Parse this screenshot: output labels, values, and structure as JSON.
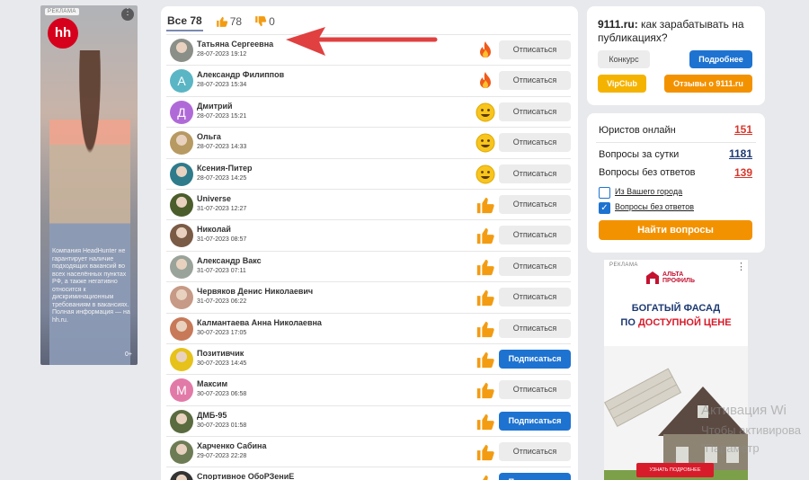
{
  "left_ad": {
    "tag": "РЕКЛАМА",
    "logo": "hh",
    "text": "Компания HeadHunter не гарантирует наличие подходящих вакансий во всех населённых пунктах РФ, а также негативно относится к дискриминационным требованиям в вакансиях. Полная информация — на hh.ru.",
    "age": "0+"
  },
  "tabs": {
    "all": "Все 78",
    "likes": "78",
    "dislikes": "0"
  },
  "rows": [
    {
      "name": "Татьяна Сергеевна",
      "date": "28-07-2023 19:12",
      "reaction": "fire",
      "button": "Отписаться",
      "subscribed": true,
      "avatar": "photo",
      "avatar_color": "#8a8f88"
    },
    {
      "name": "Александр Филиппов",
      "date": "28-07-2023 15:34",
      "reaction": "fire",
      "button": "Отписаться",
      "subscribed": true,
      "avatar": "А",
      "avatar_color": "#5ab6c4"
    },
    {
      "name": "Дмитрий",
      "date": "28-07-2023 15:21",
      "reaction": "smile",
      "button": "Отписаться",
      "subscribed": true,
      "avatar": "Д",
      "avatar_color": "#b06ad8"
    },
    {
      "name": "Ольга",
      "date": "28-07-2023 14:33",
      "reaction": "smile",
      "button": "Отписаться",
      "subscribed": true,
      "avatar": "photo",
      "avatar_color": "#b79a62"
    },
    {
      "name": "Ксения-Питер",
      "date": "28-07-2023 14:25",
      "reaction": "smile",
      "button": "Отписаться",
      "subscribed": true,
      "avatar": "photo",
      "avatar_color": "#2e7b8c"
    },
    {
      "name": "Universe",
      "date": "31-07-2023 12:27",
      "reaction": "like",
      "button": "Отписаться",
      "subscribed": true,
      "avatar": "photo",
      "avatar_color": "#4b5d2b"
    },
    {
      "name": "Николай",
      "date": "31-07-2023 08:57",
      "reaction": "like",
      "button": "Отписаться",
      "subscribed": true,
      "avatar": "photo",
      "avatar_color": "#7a5b45"
    },
    {
      "name": "Александр Вакс",
      "date": "31-07-2023 07:11",
      "reaction": "like",
      "button": "Отписаться",
      "subscribed": true,
      "avatar": "photo",
      "avatar_color": "#9aa39a"
    },
    {
      "name": "Червяков Денис Николаевич",
      "date": "31-07-2023 06:22",
      "reaction": "like",
      "button": "Отписаться",
      "subscribed": true,
      "avatar": "photo",
      "avatar_color": "#c69a86"
    },
    {
      "name": "Калмантаева Анна Николаевна",
      "date": "30-07-2023 17:05",
      "reaction": "like",
      "button": "Отписаться",
      "subscribed": true,
      "avatar": "photo",
      "avatar_color": "#c87958"
    },
    {
      "name": "Позитивчик",
      "date": "30-07-2023 14:45",
      "reaction": "like",
      "button": "Подписаться",
      "subscribed": false,
      "avatar": "photo",
      "avatar_color": "#e6c21a"
    },
    {
      "name": "Максим",
      "date": "30-07-2023 06:58",
      "reaction": "like",
      "button": "Отписаться",
      "subscribed": true,
      "avatar": "М",
      "avatar_color": "#e27aa8"
    },
    {
      "name": "ДМБ-95",
      "date": "30-07-2023 01:58",
      "reaction": "like",
      "button": "Подписаться",
      "subscribed": false,
      "avatar": "photo",
      "avatar_color": "#5a6b3f"
    },
    {
      "name": "Харченко Сабина",
      "date": "29-07-2023 22:28",
      "reaction": "like",
      "button": "Отписаться",
      "subscribed": true,
      "avatar": "photo",
      "avatar_color": "#6d7c55"
    },
    {
      "name": "Спортивное ОбоРЗениЕ",
      "date": "",
      "reaction": "like",
      "button": "Подписаться",
      "subscribed": false,
      "avatar": "photo",
      "avatar_color": "#333333"
    }
  ],
  "promo": {
    "site": "9111.ru:",
    "question": " как зарабатывать на публикациях?",
    "course": "Конкурс",
    "more": "Подробнее",
    "vip": "VipClub",
    "reviews": "Отзывы о 9111.ru"
  },
  "stats": {
    "lawyers_label": "Юристов онлайн",
    "lawyers_value": "151",
    "questions_day_label": "Вопросы за сутки",
    "questions_day_value": "1181",
    "unanswered_label": "Вопросы без ответов",
    "unanswered_value": "139",
    "city_label": "Из Вашего города",
    "city_checked": false,
    "no_answers_label": "Вопросы без ответов",
    "no_answers_checked": true,
    "find_button": "Найти вопросы"
  },
  "right_ad": {
    "tag": "РЕКЛАМА",
    "brand_line1": "АЛЬТА",
    "brand_line2": "ПРОФИЛЬ",
    "slogan_line1": "БОГАТЫЙ ФАСАД",
    "slogan_line2a": "ПО ",
    "slogan_line2b": "ДОСТУПНОЙ ЦЕНЕ",
    "cta": "УЗНАТЬ ПОДРОБНЕЕ"
  },
  "watermark": {
    "line1": "Активация Wi",
    "line2": "Чтобы активирова",
    "line3": "\"Параметр"
  }
}
